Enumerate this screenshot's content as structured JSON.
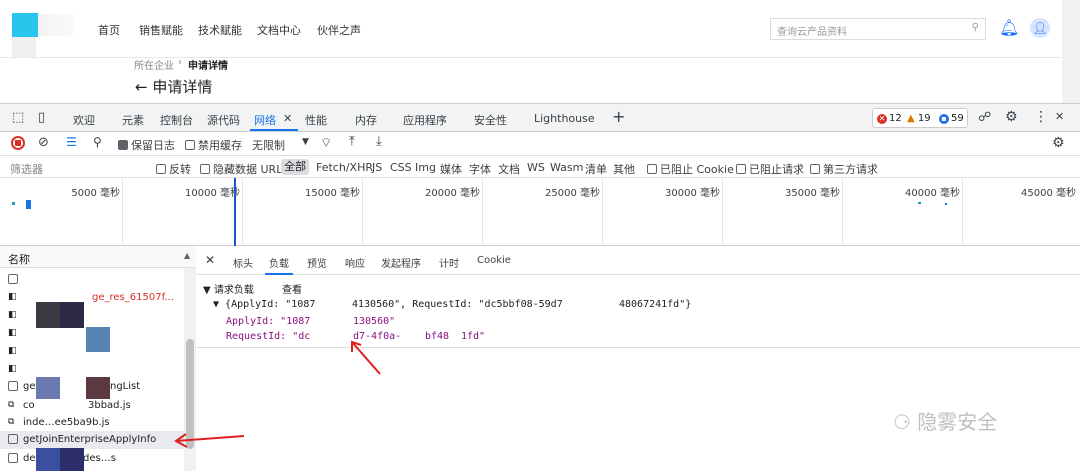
{
  "site": {
    "nav": [
      "首页",
      "销售赋能",
      "技术赋能",
      "文档中心",
      "伙伴之声"
    ],
    "search_placeholder": "查询云产品资料",
    "breadcrumb_parent": "所在企业",
    "breadcrumb_current": "申请详情",
    "page_title": "申请详情"
  },
  "devtools": {
    "tabs": [
      "欢迎",
      "元素",
      "控制台",
      "源代码",
      "网络",
      "性能",
      "内存",
      "应用程序",
      "安全性",
      "Lighthouse"
    ],
    "active_tab": "网络",
    "errors": "12",
    "warnings": "19",
    "messages": "59"
  },
  "network_toolbar": {
    "preserve_log": "保留日志",
    "disable_cache": "禁用缓存",
    "throttle": "无限制"
  },
  "filter_bar": {
    "placeholder": "筛选器",
    "invert": "反转",
    "hide_data_urls": "隐藏数据 URL",
    "types": [
      "全部",
      "Fetch/XHR",
      "JS",
      "CSS",
      "Img",
      "媒体",
      "字体",
      "文档",
      "WS",
      "Wasm",
      "清单",
      "其他"
    ],
    "blocked_cookies": "已阻止 Cookie",
    "blocked_requests": "已阻止请求",
    "third_party": "第三方请求"
  },
  "timeline": {
    "ticks": [
      "5000 毫秒",
      "10000 毫秒",
      "15000 毫秒",
      "20000 毫秒",
      "25000 毫秒",
      "30000 毫秒",
      "35000 毫秒",
      "40000 毫秒",
      "45000 毫秒"
    ]
  },
  "request_list": {
    "header": "名称",
    "rows": [
      {
        "name": "ge_res_61507f..."
      },
      {
        "name": "getJoinEnterpriseApplyInfo"
      },
      {
        "name": "ngList"
      },
      {
        "name": "3bbad.js"
      },
      {
        "name": "inde…ee5ba9b.js"
      },
      {
        "name": "des…s"
      }
    ],
    "row_prefixes": [
      "get",
      "co",
      "inde",
      "des"
    ]
  },
  "detail": {
    "tabs": [
      "标头",
      "负载",
      "预览",
      "响应",
      "发起程序",
      "计时",
      "Cookie"
    ],
    "active_tab": "负载",
    "section_title": "请求负载",
    "view_source": "查看",
    "summary_a": "{ApplyId: \"1087",
    "summary_b": "4130560\", RequestId: \"dc5bbf08-59d7",
    "summary_c": "48067241fd\"}",
    "apply_key": "ApplyId: \"1087",
    "apply_tail": "130560\"",
    "req_key": "RequestId: \"dc",
    "req_mid": "d7-4f0a-",
    "req_mid2": "bf48",
    "req_tail": "1fd\""
  },
  "watermark": "隐雾安全"
}
